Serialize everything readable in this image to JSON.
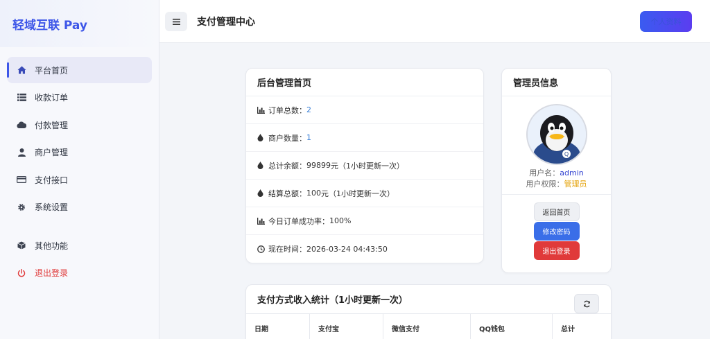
{
  "brand": "轻域互联 Pay",
  "nav": [
    {
      "label": "平台首页",
      "icon": "home-icon"
    },
    {
      "label": "收款订单",
      "icon": "list-icon"
    },
    {
      "label": "付款管理",
      "icon": "cloud-icon"
    },
    {
      "label": "商户管理",
      "icon": "user-icon"
    },
    {
      "label": "支付接口",
      "icon": "credit-card-icon"
    },
    {
      "label": "系统设置",
      "icon": "gear-icon"
    },
    {
      "label": "其他功能",
      "icon": "cube-icon"
    },
    {
      "label": "退出登录",
      "icon": "power-icon"
    }
  ],
  "header": {
    "title": "支付管理中心",
    "button_label": "个人资料"
  },
  "stats": {
    "title": "后台管理首页",
    "rows": [
      {
        "label": "订单总数：",
        "value": "2",
        "suffix": ""
      },
      {
        "label": "商户数量：",
        "value": "1",
        "suffix": ""
      },
      {
        "label": "总计余额：",
        "value": "99899",
        "suffix": " 元（1小时更新一次）"
      },
      {
        "label": "结算总额：",
        "value": "100",
        "suffix": " 元（1小时更新一次）"
      },
      {
        "label": "今日订单成功率：",
        "value": "100",
        "suffix": " %"
      },
      {
        "label": "现在时间：",
        "value": "2026-03-24 04:43:50",
        "suffix": ""
      }
    ]
  },
  "admin": {
    "title": "管理员信息",
    "username_label": "用户名：",
    "username": "admin",
    "role_label": "用户权限：",
    "role": "管理员",
    "btn_home": "返回首页",
    "btn_pwd": "修改密码",
    "btn_logout": "退出登录"
  },
  "income": {
    "title": "支付方式收入统计（1小时更新一次）",
    "columns": [
      "日期",
      "支付宝",
      "微信支付",
      "QQ钱包",
      "总计"
    ]
  },
  "colors": {
    "accent": "#3d56e8",
    "danger": "#e03a3a",
    "role": "#e5a40e",
    "value_blue": "#3a7fd6"
  }
}
